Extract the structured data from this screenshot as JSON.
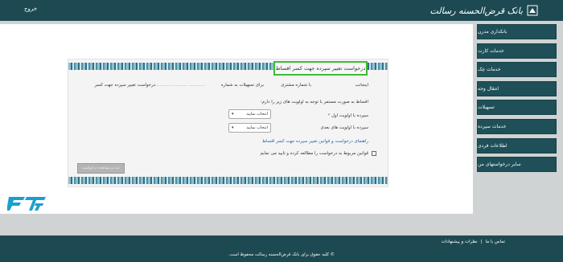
{
  "header": {
    "logout_label": "خروج",
    "bank_name": "بانک قرض‌الحسنه رسالت"
  },
  "sidebar": {
    "items": [
      {
        "label": "بانکداری مدرن"
      },
      {
        "label": "خدمات کارت"
      },
      {
        "label": "خدمات چک"
      },
      {
        "label": "انتقال وجه"
      },
      {
        "label": "تسهیلات"
      },
      {
        "label": "خدمات سپرده"
      },
      {
        "label": "اطلاعات فردی"
      },
      {
        "label": "سایر درخواستهای من"
      }
    ]
  },
  "form": {
    "title": "درخواست تغییر سپرده جهت کسر اقساط",
    "intro_line": {
      "part1": "اینجانب",
      "part2": "با شماره مشتری",
      "part3": "برای تسهیلات به شماره",
      "dots": "............  ............  ............",
      "part4": "درخواست تغییر سپرده جهت کسر"
    },
    "instruction": "اقساط به صورت مستمر با توجه به اولویت های زیر را دارم:",
    "field1_label": "سپرده با اولویت اول",
    "required_mark": "*",
    "field1_value": "انتخاب نمایید",
    "field2_label": "سپرده با اولویت های بعدی",
    "field2_value": "انتخاب نمایید",
    "guide_link": "راهنمای درخواست و قوانین تغییر سپرده جهت کسر اقساط",
    "agree_text": "قوانین مربوط به درخواست را مطالعه کرده و تایید می نمایم",
    "submit_label": "ثبت و مشاهده درخواست"
  },
  "footer": {
    "contact": "تماس با ما",
    "separator": "|",
    "feedback": "نظرات و پیشنهادات",
    "copyright": "© کلیه حقوق برای بانک قرض‌الحسنه رسالت محفوظ است."
  },
  "colors": {
    "header_bg": "#1d4a52",
    "sidebar_bg": "#1f5059",
    "title_border": "#3bbd33",
    "link": "#1c5ea8"
  }
}
